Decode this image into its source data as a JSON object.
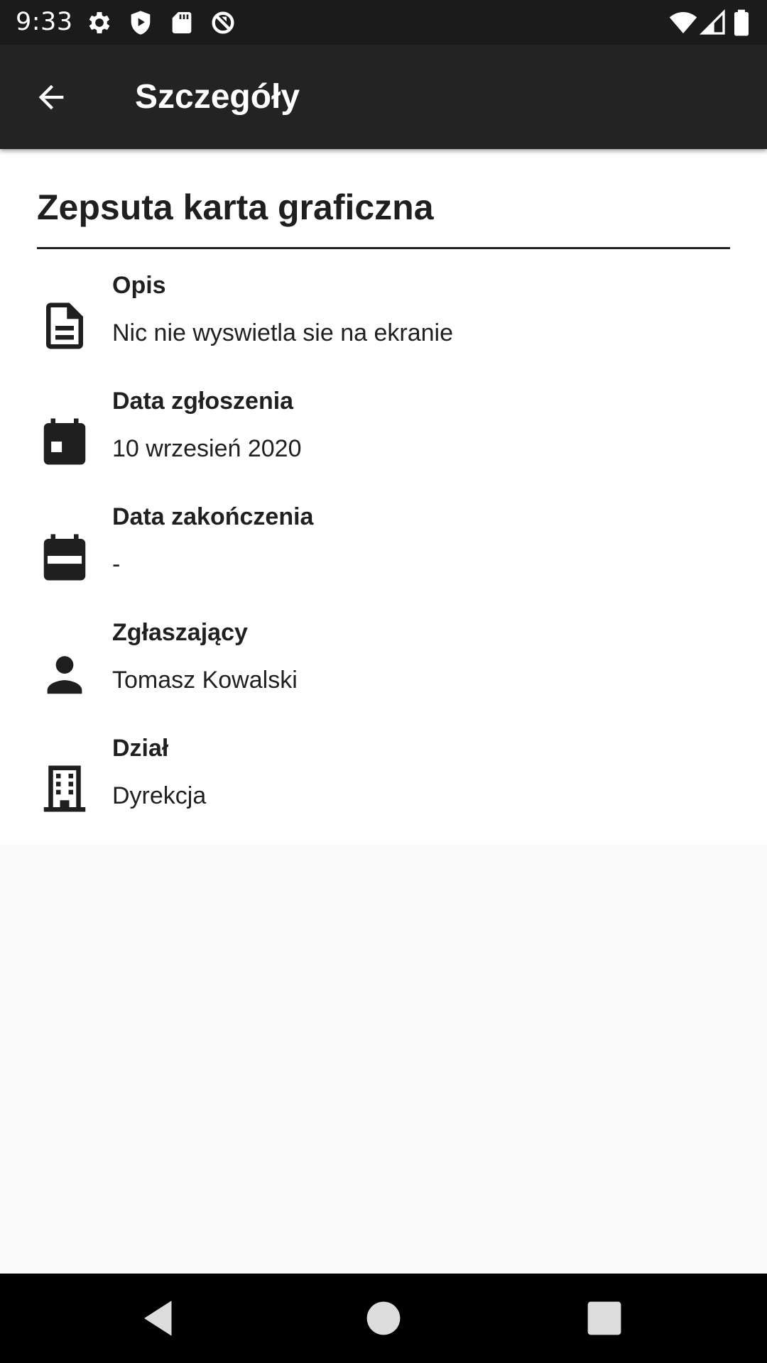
{
  "status_bar": {
    "time": "9:33",
    "icons_left": [
      "gear-icon",
      "shield-play-icon",
      "sd-card-icon",
      "no-sync-icon"
    ],
    "icons_right": [
      "wifi-icon",
      "cellular-signal-icon",
      "battery-icon"
    ]
  },
  "app_bar": {
    "title": "Szczegóły",
    "back_icon": "arrow-back-icon"
  },
  "ticket": {
    "title": "Zepsuta karta graficzna",
    "details": [
      {
        "icon": "document-icon",
        "label": "Opis",
        "value": "Nic nie wyswietla sie na ekranie"
      },
      {
        "icon": "calendar-event-icon",
        "label": "Data zgłoszenia",
        "value": "10 wrzesień 2020"
      },
      {
        "icon": "calendar-range-icon",
        "label": "Data zakończenia",
        "value": "-"
      },
      {
        "icon": "person-icon",
        "label": "Zgłaszający",
        "value": "Tomasz Kowalski"
      },
      {
        "icon": "building-icon",
        "label": "Dział",
        "value": "Dyrekcja"
      }
    ]
  },
  "nav_bar": {
    "buttons": [
      "back-triangle-icon",
      "home-circle-icon",
      "recents-square-icon"
    ]
  },
  "colors": {
    "status_bar_bg": "#1b1b1b",
    "app_bar_bg": "#232323",
    "content_bg": "#ffffff",
    "page_bg": "#fafafa",
    "text_primary": "#202020",
    "icon_color": "#1f1f1f"
  }
}
